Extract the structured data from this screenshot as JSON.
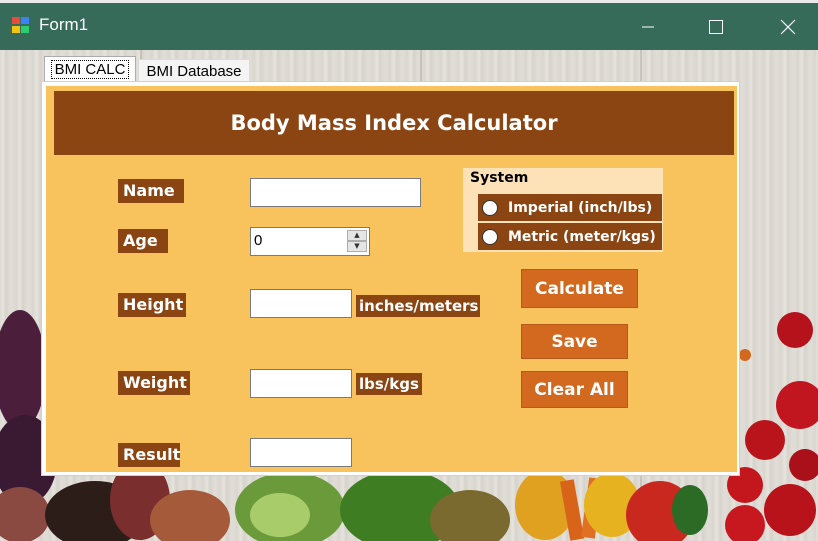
{
  "window": {
    "title": "Form1",
    "controls": {
      "minimize": "–",
      "maximize": "□",
      "close": "✕"
    }
  },
  "tabs": [
    {
      "label": "BMI CALC",
      "active": true
    },
    {
      "label": "BMI Database",
      "active": false
    }
  ],
  "header": {
    "title": "Body Mass Index Calculator"
  },
  "form": {
    "name_label": "Name",
    "name_value": "",
    "age_label": "Age",
    "age_value": "0",
    "height_label": "Height",
    "height_value": "",
    "height_unit": "inches/meters",
    "weight_label": "Weight",
    "weight_value": "",
    "weight_unit": "lbs/kgs",
    "result_label": "Result",
    "result_value": ""
  },
  "system": {
    "title": "System",
    "options": [
      {
        "label": "Imperial (inch/lbs)",
        "checked": false
      },
      {
        "label": "Metric (meter/kgs)",
        "checked": false
      }
    ]
  },
  "buttons": {
    "calculate": "Calculate",
    "save": "Save",
    "clear_all": "Clear All"
  },
  "colors": {
    "titlebar": "#366b5a",
    "panel": "#f8c25d",
    "header": "#8b4513",
    "button": "#d2691e"
  }
}
